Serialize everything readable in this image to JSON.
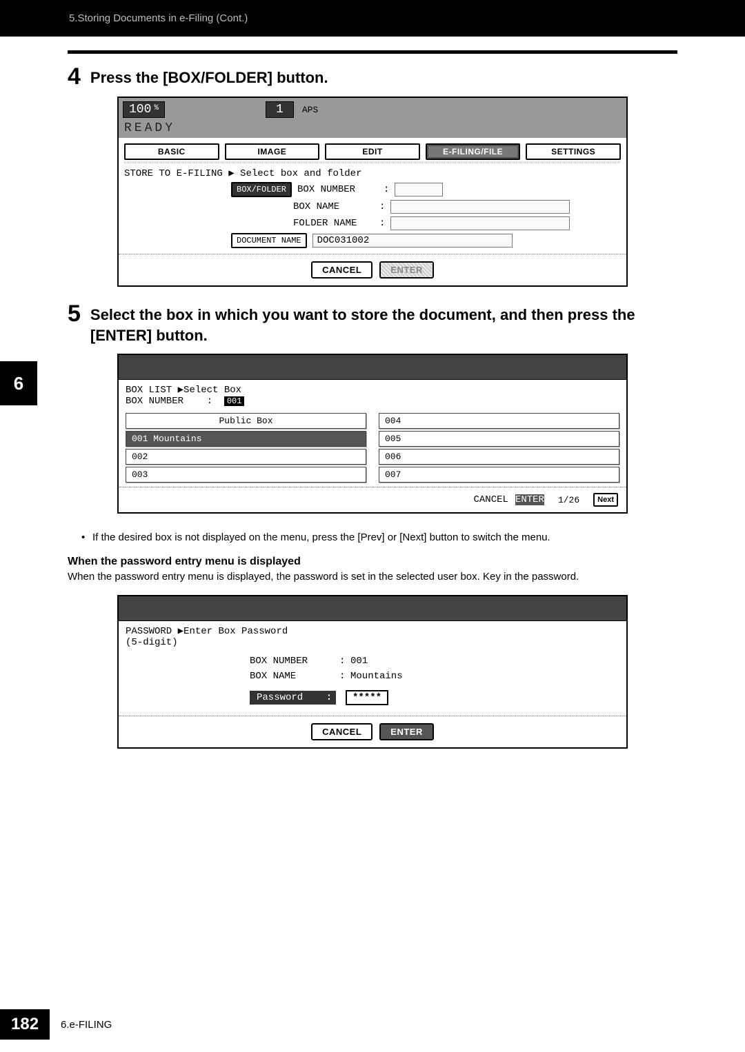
{
  "banner": "5.Storing Documents in e-Filing (Cont.)",
  "chapter_tab": "6",
  "step4": {
    "num": "4",
    "title": "Press the [BOX/FOLDER] button.",
    "screen": {
      "ratio": "100",
      "ratio_unit": "%",
      "count": "1",
      "aps": "APS",
      "ready": "READY",
      "tabs": {
        "basic": "BASIC",
        "image": "IMAGE",
        "edit": "EDIT",
        "efiling": "E-FILING/FILE",
        "settings": "SETTINGS"
      },
      "instr": "STORE TO E-FILING  ▶ Select box and folder",
      "box_folder_btn": "BOX/FOLDER",
      "box_number_lbl": "BOX NUMBER",
      "box_name_lbl": "BOX NAME",
      "folder_name_lbl": "FOLDER NAME",
      "doc_name_btn": "DOCUMENT NAME",
      "doc_name_val": "DOC031002",
      "cancel": "CANCEL",
      "enter": "ENTER"
    }
  },
  "step5": {
    "num": "5",
    "title": "Select the box in which you want to store the document, and then press the [ENTER] button.",
    "screen": {
      "heading1": "BOX LIST ▶Select Box",
      "box_number_lbl": "BOX NUMBER",
      "box_number_val": "001",
      "items_left": [
        "Public Box",
        "001 Mountains",
        "002",
        "003"
      ],
      "items_right": [
        "004",
        "005",
        "006",
        "007"
      ],
      "selected_index": 1,
      "cancel": "CANCEL",
      "enter": "ENTER",
      "page": "1/26",
      "next": "Next"
    },
    "bullet": "If the desired box is not displayed on the menu, press the [Prev] or [Next] button to switch the menu.",
    "sub_heading": "When the password entry menu is displayed",
    "sub_para": "When the password entry menu is displayed, the password is set in the selected user box. Key in the password.",
    "pw_screen": {
      "heading": "PASSWORD ▶Enter Box Password",
      "subheading": "(5-digit)",
      "box_number_lbl": "BOX NUMBER",
      "box_number_val": "001",
      "box_name_lbl": "BOX NAME",
      "box_name_val": "Mountains",
      "password_lbl": "Password",
      "password_val": "*****",
      "cancel": "CANCEL",
      "enter": "ENTER"
    }
  },
  "footer": {
    "page": "182",
    "label": "6.e-FILING"
  }
}
